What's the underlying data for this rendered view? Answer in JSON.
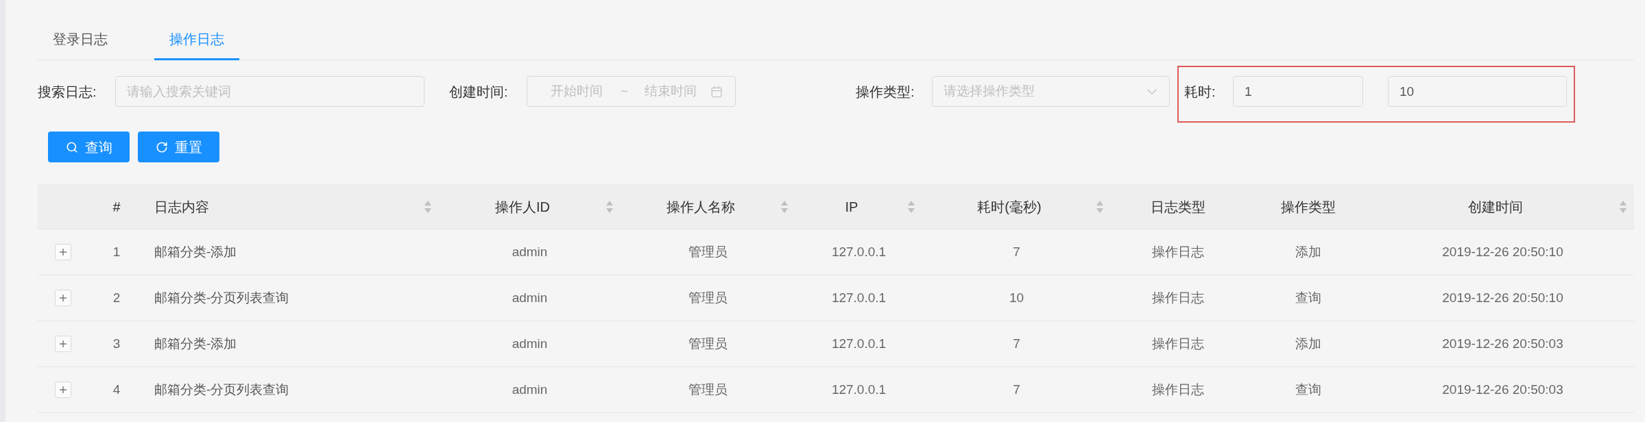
{
  "tabs": [
    {
      "label": "登录日志",
      "selected": false
    },
    {
      "label": "操作日志",
      "selected": true
    }
  ],
  "filters": {
    "search": {
      "label": "搜索日志:",
      "placeholder": "请输入搜索关键词"
    },
    "created_time": {
      "label": "创建时间:",
      "start_placeholder": "开始时间",
      "separator": "~",
      "end_placeholder": "结束时间"
    },
    "operation_type": {
      "label": "操作类型:",
      "placeholder": "请选择操作类型"
    },
    "duration": {
      "label": "耗时:",
      "min": "1",
      "max": "10"
    }
  },
  "buttons": [
    {
      "kind": "search",
      "label": "查询"
    },
    {
      "kind": "reset",
      "label": "重置"
    }
  ],
  "table": {
    "columns": [
      {
        "label": "#",
        "sortable": false
      },
      {
        "label": "日志内容",
        "sortable": true
      },
      {
        "label": "操作人ID",
        "sortable": true
      },
      {
        "label": "操作人名称",
        "sortable": true
      },
      {
        "label": "IP",
        "sortable": true
      },
      {
        "label": "耗时(毫秒)",
        "sortable": true
      },
      {
        "label": "日志类型",
        "sortable": false
      },
      {
        "label": "操作类型",
        "sortable": false
      },
      {
        "label": "创建时间",
        "sortable": true
      }
    ],
    "rows": [
      {
        "expanded": false,
        "cells": [
          "1",
          "邮箱分类-添加",
          "admin",
          "管理员",
          "127.0.0.1",
          "7",
          "操作日志",
          "添加",
          "2019-12-26 20:50:10"
        ]
      },
      {
        "expanded": false,
        "cells": [
          "2",
          "邮箱分类-分页列表查询",
          "admin",
          "管理员",
          "127.0.0.1",
          "10",
          "操作日志",
          "查询",
          "2019-12-26 20:50:10"
        ]
      },
      {
        "expanded": false,
        "cells": [
          "3",
          "邮箱分类-添加",
          "admin",
          "管理员",
          "127.0.0.1",
          "7",
          "操作日志",
          "添加",
          "2019-12-26 20:50:03"
        ]
      },
      {
        "expanded": false,
        "cells": [
          "4",
          "邮箱分类-分页列表查询",
          "admin",
          "管理员",
          "127.0.0.1",
          "7",
          "操作日志",
          "查询",
          "2019-12-26 20:50:03"
        ]
      }
    ]
  }
}
